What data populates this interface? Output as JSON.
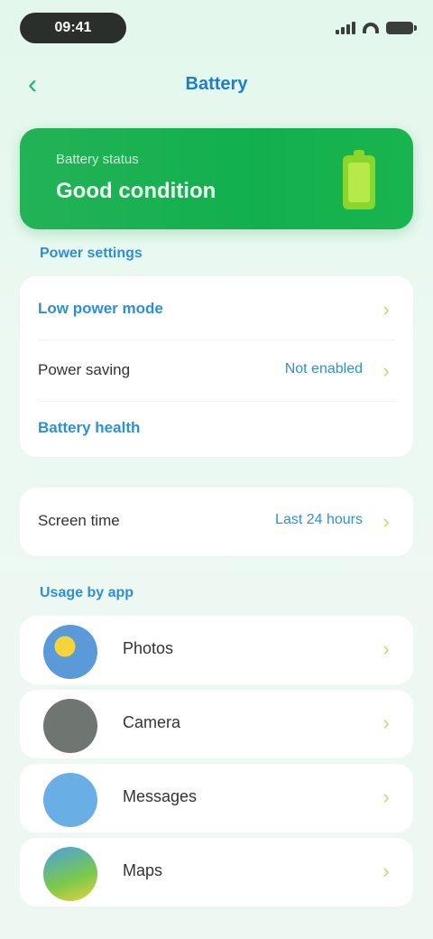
{
  "status_bar": {
    "time": "09:41"
  },
  "nav": {
    "title": "Battery"
  },
  "hero": {
    "caption": "Battery status",
    "status": "Good condition",
    "level_fraction": 0.75,
    "color": "#12b04d",
    "icon": "battery-icon"
  },
  "section1": {
    "label": "Power settings"
  },
  "card1": {
    "rows": [
      {
        "label": "Low power mode",
        "style": "blue"
      },
      {
        "label": "Power saving",
        "value": "Not enabled"
      },
      {
        "label": "Battery health",
        "style": "blue"
      }
    ]
  },
  "card2": {
    "rows": [
      {
        "label": "Screen time",
        "value": "Last 24 hours"
      }
    ]
  },
  "section2": {
    "label": "Usage by app"
  },
  "apps": [
    {
      "name": "Photos",
      "icon_color": "#5b9ad8"
    },
    {
      "name": "Camera",
      "icon_color": "#6f7570"
    },
    {
      "name": "Messages",
      "icon_color": "#6aaee6"
    },
    {
      "name": "Maps",
      "icon_color": "#7cc94a"
    }
  ],
  "colors": {
    "accent_green": "#1bb46a",
    "accent_blue": "#2f8fd6",
    "chevron": "#b9e06a"
  }
}
